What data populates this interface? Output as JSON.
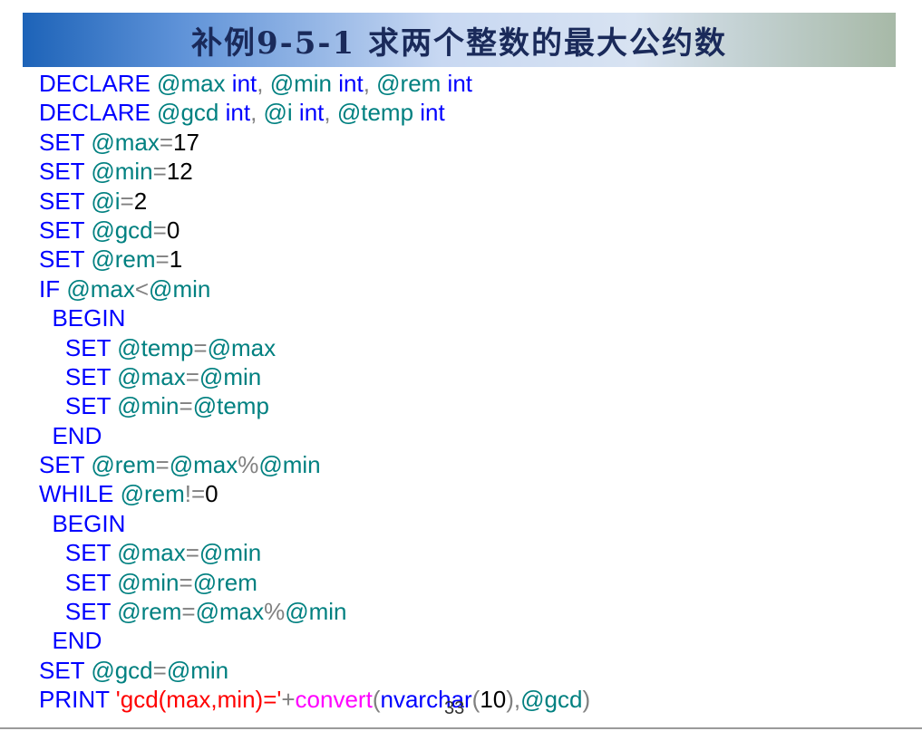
{
  "title": "补例9-5-1 求两个整数的最大公约数",
  "page_number": "33",
  "colors": {
    "keyword": "#0000ff",
    "variable": "#008080",
    "operator": "#808080",
    "number": "#000000",
    "string": "#ff0000",
    "function": "#ff00ff",
    "title_text": "#1a2a5a"
  },
  "code_lines": [
    [
      {
        "t": "kw",
        "v": "DECLARE "
      },
      {
        "t": "var",
        "v": "@max"
      },
      {
        "t": "kw",
        "v": " int"
      },
      {
        "t": "op",
        "v": ", "
      },
      {
        "t": "var",
        "v": "@min"
      },
      {
        "t": "kw",
        "v": " int"
      },
      {
        "t": "op",
        "v": ", "
      },
      {
        "t": "var",
        "v": "@rem"
      },
      {
        "t": "kw",
        "v": " int"
      }
    ],
    [
      {
        "t": "kw",
        "v": "DECLARE "
      },
      {
        "t": "var",
        "v": "@gcd"
      },
      {
        "t": "kw",
        "v": " int"
      },
      {
        "t": "op",
        "v": ", "
      },
      {
        "t": "var",
        "v": "@i"
      },
      {
        "t": "kw",
        "v": " int"
      },
      {
        "t": "op",
        "v": ", "
      },
      {
        "t": "var",
        "v": "@temp"
      },
      {
        "t": "kw",
        "v": " int"
      }
    ],
    [
      {
        "t": "kw",
        "v": "SET "
      },
      {
        "t": "var",
        "v": "@max"
      },
      {
        "t": "op",
        "v": "="
      },
      {
        "t": "num",
        "v": "17"
      }
    ],
    [
      {
        "t": "kw",
        "v": "SET "
      },
      {
        "t": "var",
        "v": "@min"
      },
      {
        "t": "op",
        "v": "="
      },
      {
        "t": "num",
        "v": "12"
      }
    ],
    [
      {
        "t": "kw",
        "v": "SET "
      },
      {
        "t": "var",
        "v": "@i"
      },
      {
        "t": "op",
        "v": "="
      },
      {
        "t": "num",
        "v": "2"
      }
    ],
    [
      {
        "t": "kw",
        "v": "SET "
      },
      {
        "t": "var",
        "v": "@gcd"
      },
      {
        "t": "op",
        "v": "="
      },
      {
        "t": "num",
        "v": "0"
      }
    ],
    [
      {
        "t": "kw",
        "v": "SET "
      },
      {
        "t": "var",
        "v": "@rem"
      },
      {
        "t": "op",
        "v": "="
      },
      {
        "t": "num",
        "v": "1"
      }
    ],
    [
      {
        "t": "kw",
        "v": "IF "
      },
      {
        "t": "var",
        "v": "@max"
      },
      {
        "t": "op",
        "v": "<"
      },
      {
        "t": "var",
        "v": "@min"
      }
    ],
    [
      {
        "t": "kw",
        "v": "  BEGIN"
      }
    ],
    [
      {
        "t": "kw",
        "v": "    SET "
      },
      {
        "t": "var",
        "v": "@temp"
      },
      {
        "t": "op",
        "v": "="
      },
      {
        "t": "var",
        "v": "@max"
      }
    ],
    [
      {
        "t": "kw",
        "v": "    SET "
      },
      {
        "t": "var",
        "v": "@max"
      },
      {
        "t": "op",
        "v": "="
      },
      {
        "t": "var",
        "v": "@min"
      }
    ],
    [
      {
        "t": "kw",
        "v": "    SET "
      },
      {
        "t": "var",
        "v": "@min"
      },
      {
        "t": "op",
        "v": "="
      },
      {
        "t": "var",
        "v": "@temp"
      }
    ],
    [
      {
        "t": "kw",
        "v": "  END"
      }
    ],
    [
      {
        "t": "kw",
        "v": "SET "
      },
      {
        "t": "var",
        "v": "@rem"
      },
      {
        "t": "op",
        "v": "="
      },
      {
        "t": "var",
        "v": "@max"
      },
      {
        "t": "op",
        "v": "%"
      },
      {
        "t": "var",
        "v": "@min"
      }
    ],
    [
      {
        "t": "kw",
        "v": "WHILE "
      },
      {
        "t": "var",
        "v": "@rem"
      },
      {
        "t": "op",
        "v": "!="
      },
      {
        "t": "num",
        "v": "0"
      }
    ],
    [
      {
        "t": "kw",
        "v": "  BEGIN"
      }
    ],
    [
      {
        "t": "kw",
        "v": "    SET "
      },
      {
        "t": "var",
        "v": "@max"
      },
      {
        "t": "op",
        "v": "="
      },
      {
        "t": "var",
        "v": "@min"
      }
    ],
    [
      {
        "t": "kw",
        "v": "    SET "
      },
      {
        "t": "var",
        "v": "@min"
      },
      {
        "t": "op",
        "v": "="
      },
      {
        "t": "var",
        "v": "@rem"
      }
    ],
    [
      {
        "t": "kw",
        "v": "    SET "
      },
      {
        "t": "var",
        "v": "@rem"
      },
      {
        "t": "op",
        "v": "="
      },
      {
        "t": "var",
        "v": "@max"
      },
      {
        "t": "op",
        "v": "%"
      },
      {
        "t": "var",
        "v": "@min"
      }
    ],
    [
      {
        "t": "kw",
        "v": "  END"
      }
    ],
    [
      {
        "t": "kw",
        "v": "SET "
      },
      {
        "t": "var",
        "v": "@gcd"
      },
      {
        "t": "op",
        "v": "="
      },
      {
        "t": "var",
        "v": "@min"
      }
    ],
    [
      {
        "t": "kw",
        "v": "PRINT "
      },
      {
        "t": "str",
        "v": "'gcd(max,min)='"
      },
      {
        "t": "op",
        "v": "+"
      },
      {
        "t": "fn",
        "v": "convert"
      },
      {
        "t": "op",
        "v": "("
      },
      {
        "t": "kw",
        "v": "nvarchar"
      },
      {
        "t": "op",
        "v": "("
      },
      {
        "t": "num",
        "v": "10"
      },
      {
        "t": "op",
        "v": "),"
      },
      {
        "t": "var",
        "v": "@gcd"
      },
      {
        "t": "op",
        "v": ")"
      }
    ]
  ]
}
